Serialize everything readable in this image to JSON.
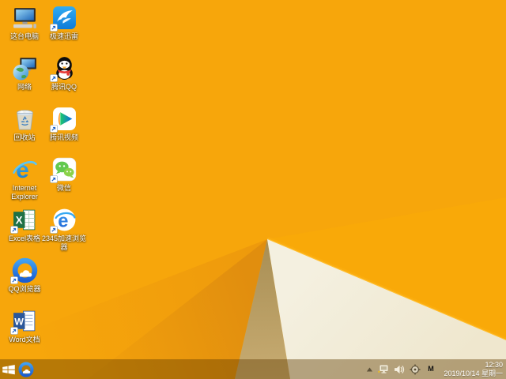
{
  "desktop": {
    "icons": [
      {
        "label": "这台电脑",
        "icon": "computer-icon",
        "col": 1,
        "row": 1,
        "shortcut_overlay": false
      },
      {
        "label": "极速迅雷",
        "icon": "xunlei-bird-icon",
        "col": 2,
        "row": 1,
        "shortcut_overlay": true
      },
      {
        "label": "网络",
        "icon": "network-globe-icon",
        "col": 1,
        "row": 2,
        "shortcut_overlay": false
      },
      {
        "label": "腾讯QQ",
        "icon": "qq-penguin-icon",
        "col": 2,
        "row": 2,
        "shortcut_overlay": true
      },
      {
        "label": "回收站",
        "icon": "recycle-bin-icon",
        "col": 1,
        "row": 3,
        "shortcut_overlay": false
      },
      {
        "label": "腾讯视频",
        "icon": "tencent-video-icon",
        "col": 2,
        "row": 3,
        "shortcut_overlay": true
      },
      {
        "label": "Internet Explorer",
        "icon": "ie-icon",
        "col": 1,
        "row": 4,
        "shortcut_overlay": false
      },
      {
        "label": "微信",
        "icon": "wechat-icon",
        "col": 2,
        "row": 4,
        "shortcut_overlay": true
      },
      {
        "label": "Excel表格",
        "icon": "excel-icon",
        "col": 1,
        "row": 5,
        "shortcut_overlay": true
      },
      {
        "label": "2345加速浏览器",
        "icon": "2345-browser-icon",
        "col": 2,
        "row": 5,
        "shortcut_overlay": true
      },
      {
        "label": "QQ浏览器",
        "icon": "qq-browser-icon",
        "col": 1,
        "row": 6,
        "shortcut_overlay": true
      },
      {
        "label": "Word文档",
        "icon": "word-icon",
        "col": 1,
        "row": 7,
        "shortcut_overlay": true
      }
    ],
    "wallpaper_colors": {
      "base_orange": "#F7A60B",
      "amber_facet": "#F9A908",
      "edge_highlight": "#FFBE2E",
      "cream_triangle": "#F2EDDB",
      "tan_triangle": "#BFA066",
      "shade_facet_1": "#EE9A0C",
      "shade_facet_2": "#E18E0E"
    }
  },
  "taskbar": {
    "start_button": {
      "icon": "windows-logo-icon"
    },
    "pinned_icons": [
      {
        "icon": "qq-browser-icon"
      }
    ],
    "tray": {
      "show_hidden_icon": "chevron-up-icon",
      "status_icons": [
        "network-warning-icon",
        "volume-icon",
        "crosshair-icon"
      ],
      "input_method": "M",
      "time": "12:30",
      "date": "2019/10/14 星期一"
    }
  }
}
